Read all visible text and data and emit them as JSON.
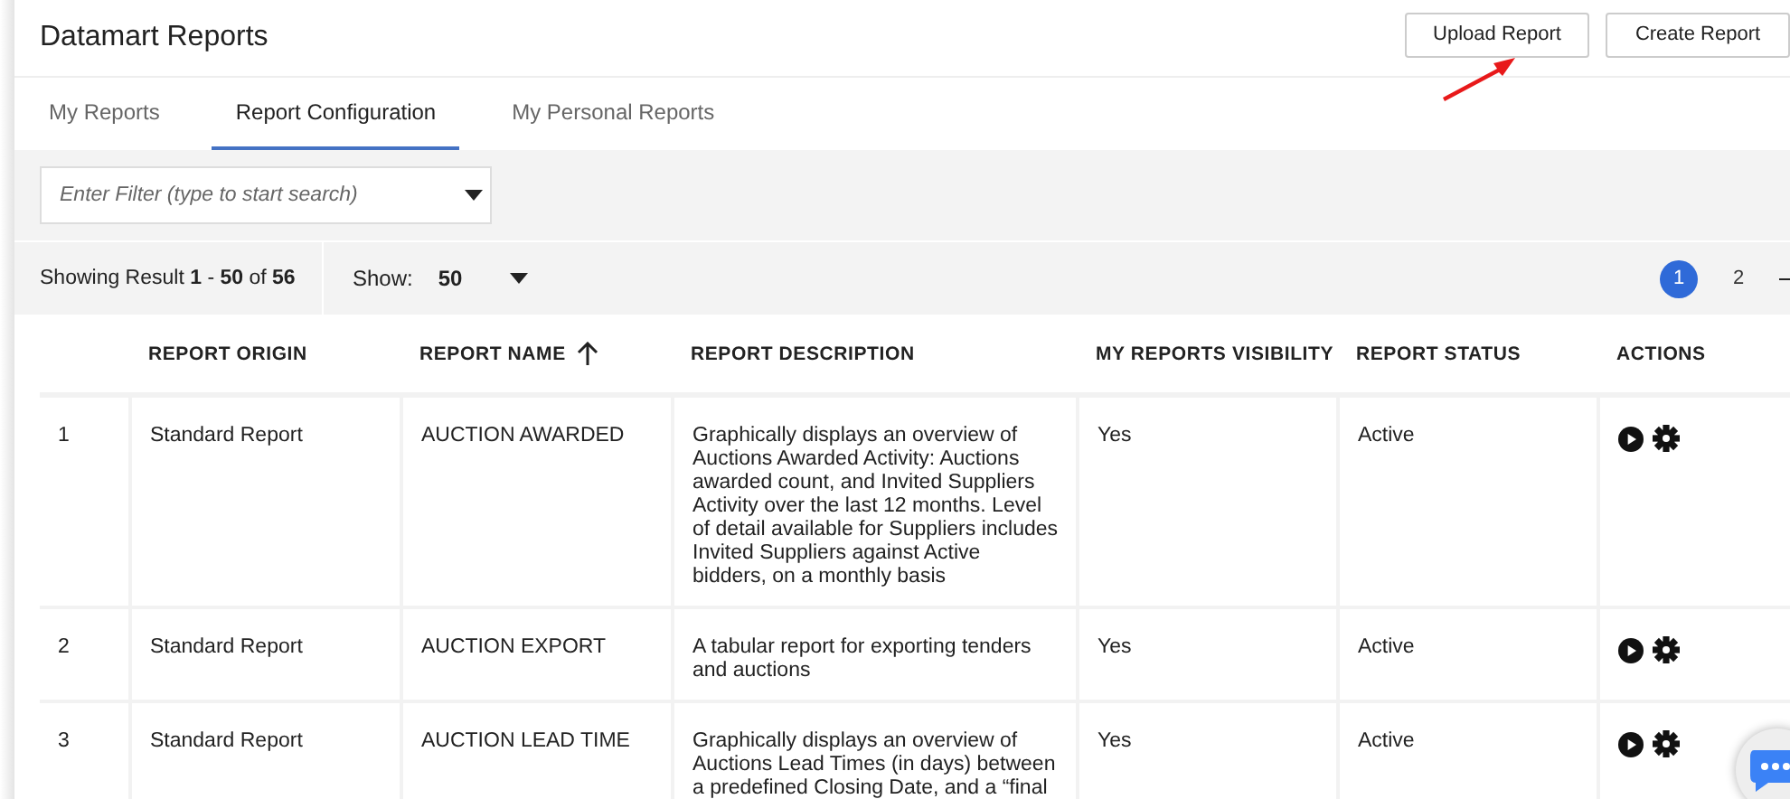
{
  "header": {
    "title": "Datamart Reports",
    "buttons": [
      "Upload Report",
      "Create Report"
    ]
  },
  "tabs": [
    {
      "label": "My Reports",
      "selected": false
    },
    {
      "label": "Report Configuration",
      "selected": true
    },
    {
      "label": "My Personal Reports",
      "selected": false
    }
  ],
  "filter": {
    "placeholder": "Enter Filter (type to start search)"
  },
  "results": {
    "summary": "Showing Result **1** - **50** of **56**",
    "show_label": "Show:",
    "show_value": "50"
  },
  "pagination": [
    {
      "label": "1",
      "selected": true
    },
    {
      "label": "2",
      "selected": false
    }
  ],
  "table": {
    "columns": [
      {
        "label": "REPORT ORIGIN",
        "sorted": false
      },
      {
        "label": "REPORT NAME",
        "sorted": true
      },
      {
        "label": "REPORT DESCRIPTION",
        "sorted": false
      },
      {
        "label": "MY REPORTS VISIBILITY",
        "sorted": false
      },
      {
        "label": "REPORT STATUS",
        "sorted": false
      },
      {
        "label": "ACTIONS",
        "sorted": false
      }
    ],
    "rows": [
      {
        "number": "1",
        "origin": "Standard Report",
        "name": "AUCTION AWARDED",
        "description": "Graphically displays an overview of Auctions Awarded Activity: Auctions awarded count, and Invited Suppliers Activity over the last 12 months. Level of detail available for Suppliers includes Invited Suppliers against Active bidders, on a monthly basis",
        "visibility": "Yes",
        "status": "Active"
      },
      {
        "number": "2",
        "origin": "Standard Report",
        "name": "AUCTION EXPORT",
        "description": "A tabular report for exporting tenders and auctions",
        "visibility": "Yes",
        "status": "Active"
      },
      {
        "number": "3",
        "origin": "Standard Report",
        "name": "AUCTION LEAD TIME",
        "description": "Graphically displays an overview of Auctions Lead Times (in days) between a predefined Closing Date, and a “final",
        "visibility": "Yes",
        "status": "Active"
      }
    ]
  }
}
